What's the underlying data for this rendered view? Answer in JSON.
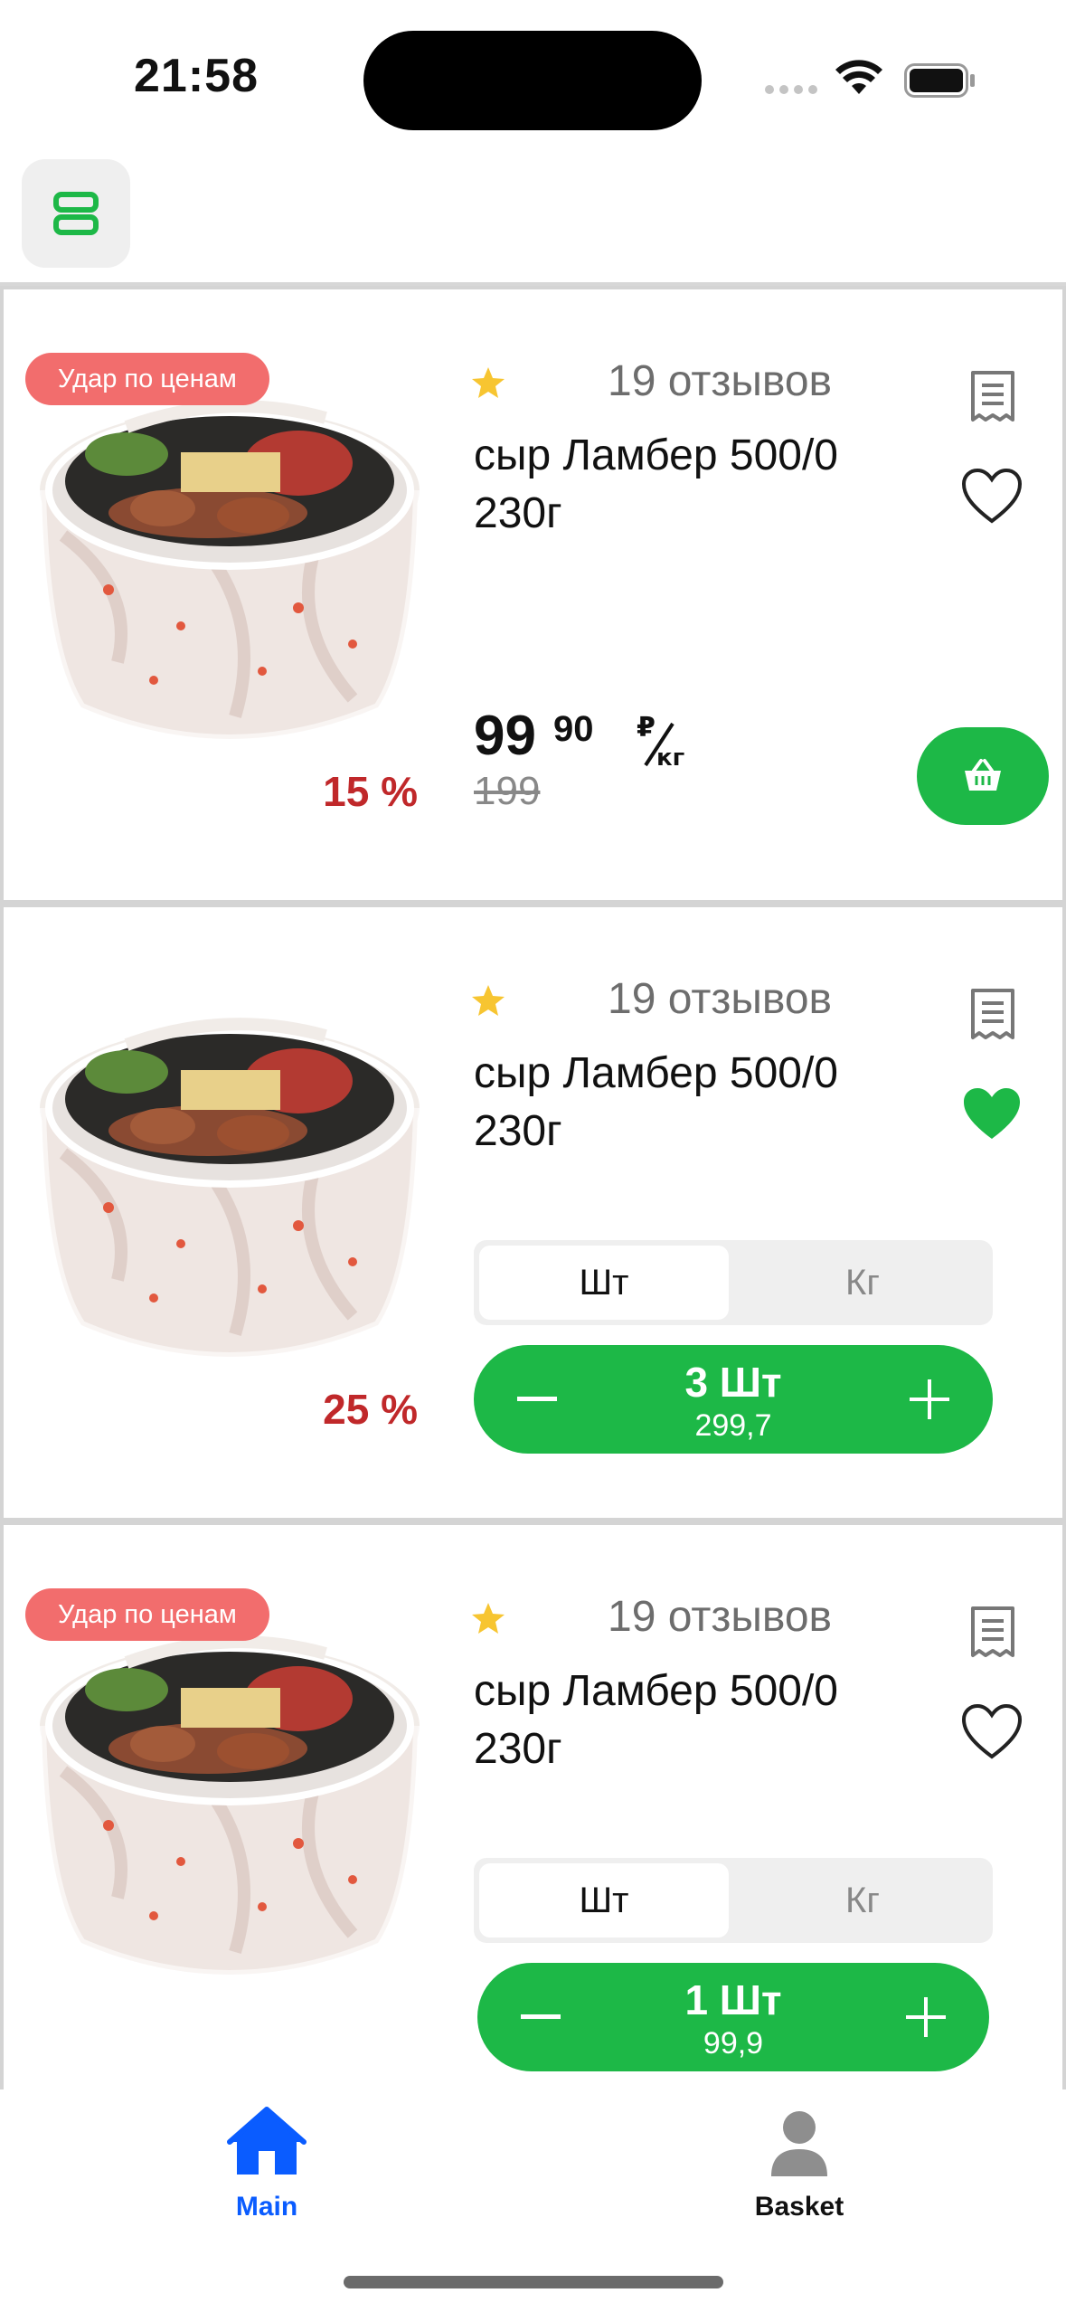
{
  "status_bar": {
    "time": "21:58"
  },
  "header": {
    "menu_icon": "list-icon"
  },
  "colors": {
    "accent": "#1db847",
    "promo": "#f26d6d",
    "discount": "#c0282a",
    "tab_active": "#0a5cff"
  },
  "products": [
    {
      "badge": "Удар по ценам",
      "discount": "15 %",
      "reviews": "19 отзывов",
      "title": "сыр Ламбер 500/0 230г",
      "favorite": false,
      "price_main": "99",
      "price_cents": "90",
      "price_old": "199"
    },
    {
      "badge": "",
      "discount": "25 %",
      "reviews": "19 отзывов",
      "title": "сыр Ламбер 500/0 230г",
      "favorite": true,
      "unit_options": [
        "Шт",
        "Кг"
      ],
      "selected_unit": "Шт",
      "quantity": "3 Шт",
      "sum": "299,7"
    },
    {
      "badge": "Удар по ценам",
      "discount": "",
      "reviews": "19 отзывов",
      "title": "сыр Ламбер 500/0 230г",
      "favorite": false,
      "unit_options": [
        "Шт",
        "Кг"
      ],
      "selected_unit": "Шт",
      "quantity": "1 Шт",
      "sum": "99,9"
    }
  ],
  "tabs": [
    {
      "label": "Main",
      "icon": "home-icon",
      "active": true
    },
    {
      "label": "Basket",
      "icon": "person-icon",
      "active": false
    }
  ]
}
